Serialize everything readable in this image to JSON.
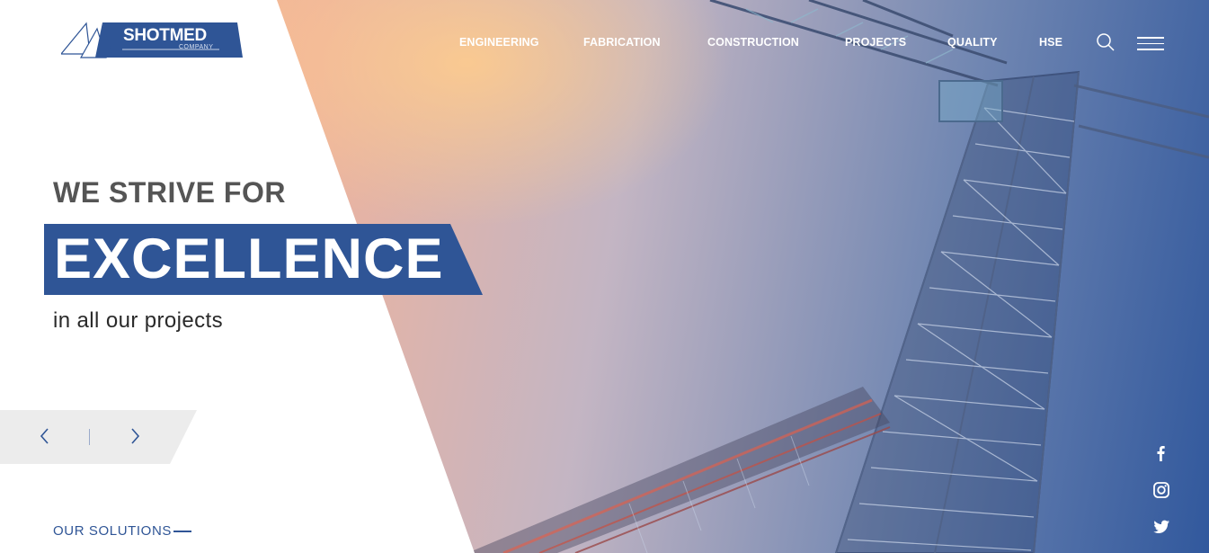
{
  "brand": {
    "name": "SHOTMED",
    "subtitle": "COMPANY",
    "color": "#2f5596"
  },
  "nav": {
    "items": [
      {
        "label": "ENGINEERING"
      },
      {
        "label": "FABRICATION"
      },
      {
        "label": "CONSTRUCTION"
      },
      {
        "label": "PROJECTS"
      },
      {
        "label": "QUALITY"
      },
      {
        "label": "HSE"
      }
    ],
    "search_icon": "search-icon",
    "menu_icon": "hamburger-menu-icon"
  },
  "hero": {
    "line1": "WE STRIVE FOR",
    "highlight": "EXCELLENCE",
    "line3": "in all our projects",
    "accent_color": "#2f5596"
  },
  "slider": {
    "prev_icon": "chevron-left-icon",
    "next_icon": "chevron-right-icon"
  },
  "solutions": {
    "label": "OUR SOLUTIONS"
  },
  "social": [
    {
      "icon": "facebook-icon"
    },
    {
      "icon": "instagram-icon"
    },
    {
      "icon": "twitter-icon"
    }
  ]
}
